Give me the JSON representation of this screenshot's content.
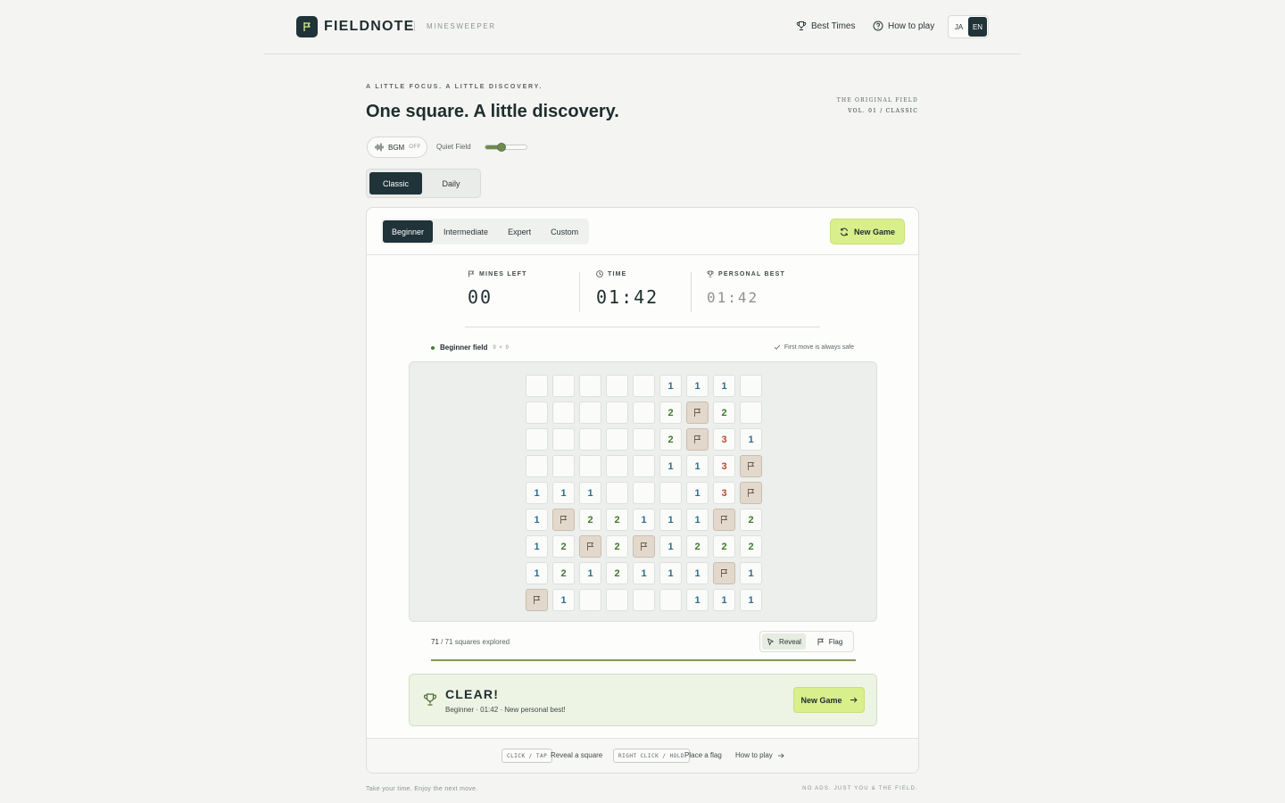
{
  "header": {
    "brand": "FIELDNOTE",
    "subtitle": "MINESWEEPER",
    "best_times": "Best Times",
    "how_to_play": "How to play",
    "lang_ja": "JA",
    "lang_en": "EN",
    "active_lang": "EN"
  },
  "hero": {
    "eyebrow": "A LITTLE FOCUS. A LITTLE DISCOVERY.",
    "headline": "One square. A little discovery.",
    "vol_line1": "THE ORIGINAL FIELD",
    "vol_line2": "VOL. 01 / CLASSIC"
  },
  "audio": {
    "bgm_label": "BGM",
    "bgm_state": "OFF",
    "quiet_label": "Quiet Field",
    "volume": 0.4
  },
  "modes": {
    "classic": "Classic",
    "daily": "Daily",
    "active": "Classic"
  },
  "levels": {
    "beginner": "Beginner",
    "intermediate": "Intermediate",
    "expert": "Expert",
    "custom": "Custom",
    "active": "Beginner",
    "new_game": "New Game"
  },
  "stats": {
    "mines_left_label": "MINES LEFT",
    "mines_left": "00",
    "time_label": "TIME",
    "time": "01:42",
    "best_label": "PERSONAL BEST",
    "best": "01:42"
  },
  "field": {
    "name": "Beginner field",
    "size": "9 × 9",
    "safe_note": "First move is always safe"
  },
  "board": [
    [
      "",
      "",
      "",
      "",
      "",
      "1",
      "1",
      "1",
      ""
    ],
    [
      "",
      "",
      "",
      "",
      "",
      "2",
      "F",
      "2",
      ""
    ],
    [
      "",
      "",
      "",
      "",
      "",
      "2",
      "F",
      "3",
      "1"
    ],
    [
      "",
      "",
      "",
      "",
      "",
      "1",
      "1",
      "3",
      "F"
    ],
    [
      "1",
      "1",
      "1",
      "",
      "",
      "",
      "1",
      "3",
      "F"
    ],
    [
      "1",
      "F",
      "2",
      "2",
      "1",
      "1",
      "1",
      "F",
      "2"
    ],
    [
      "1",
      "2",
      "F",
      "2",
      "F",
      "1",
      "2",
      "2",
      "2"
    ],
    [
      "1",
      "2",
      "1",
      "2",
      "1",
      "1",
      "1",
      "F",
      "1"
    ],
    [
      "F",
      "1",
      "",
      "",
      "",
      "",
      "1",
      "1",
      "1"
    ]
  ],
  "progress": {
    "explored": "71",
    "total": "71",
    "suffix": "squares explored",
    "fraction": 1.0,
    "reveal": "Reveal",
    "flag": "Flag",
    "active_tool": "Reveal"
  },
  "result": {
    "title": "CLEAR!",
    "detail": "Beginner · 01:42 · New personal best!",
    "button": "New Game"
  },
  "footer_hints": {
    "click_key": "CLICK / TAP",
    "click_text": "Reveal a square",
    "right_key": "RIGHT CLICK / HOLD",
    "right_text": "Place a flag",
    "how_to_play": "How to play"
  },
  "page_footer": {
    "left": "Take your time. Enjoy the next move.",
    "right": "NO ADS. JUST YOU & THE FIELD."
  },
  "colors": {
    "accent": "#d9ef8b",
    "dark": "#1f3338",
    "num1": "#2c6d8c",
    "num2": "#3f7a2e",
    "num3": "#b8492f",
    "flag_bg": "#e3d8cc"
  }
}
